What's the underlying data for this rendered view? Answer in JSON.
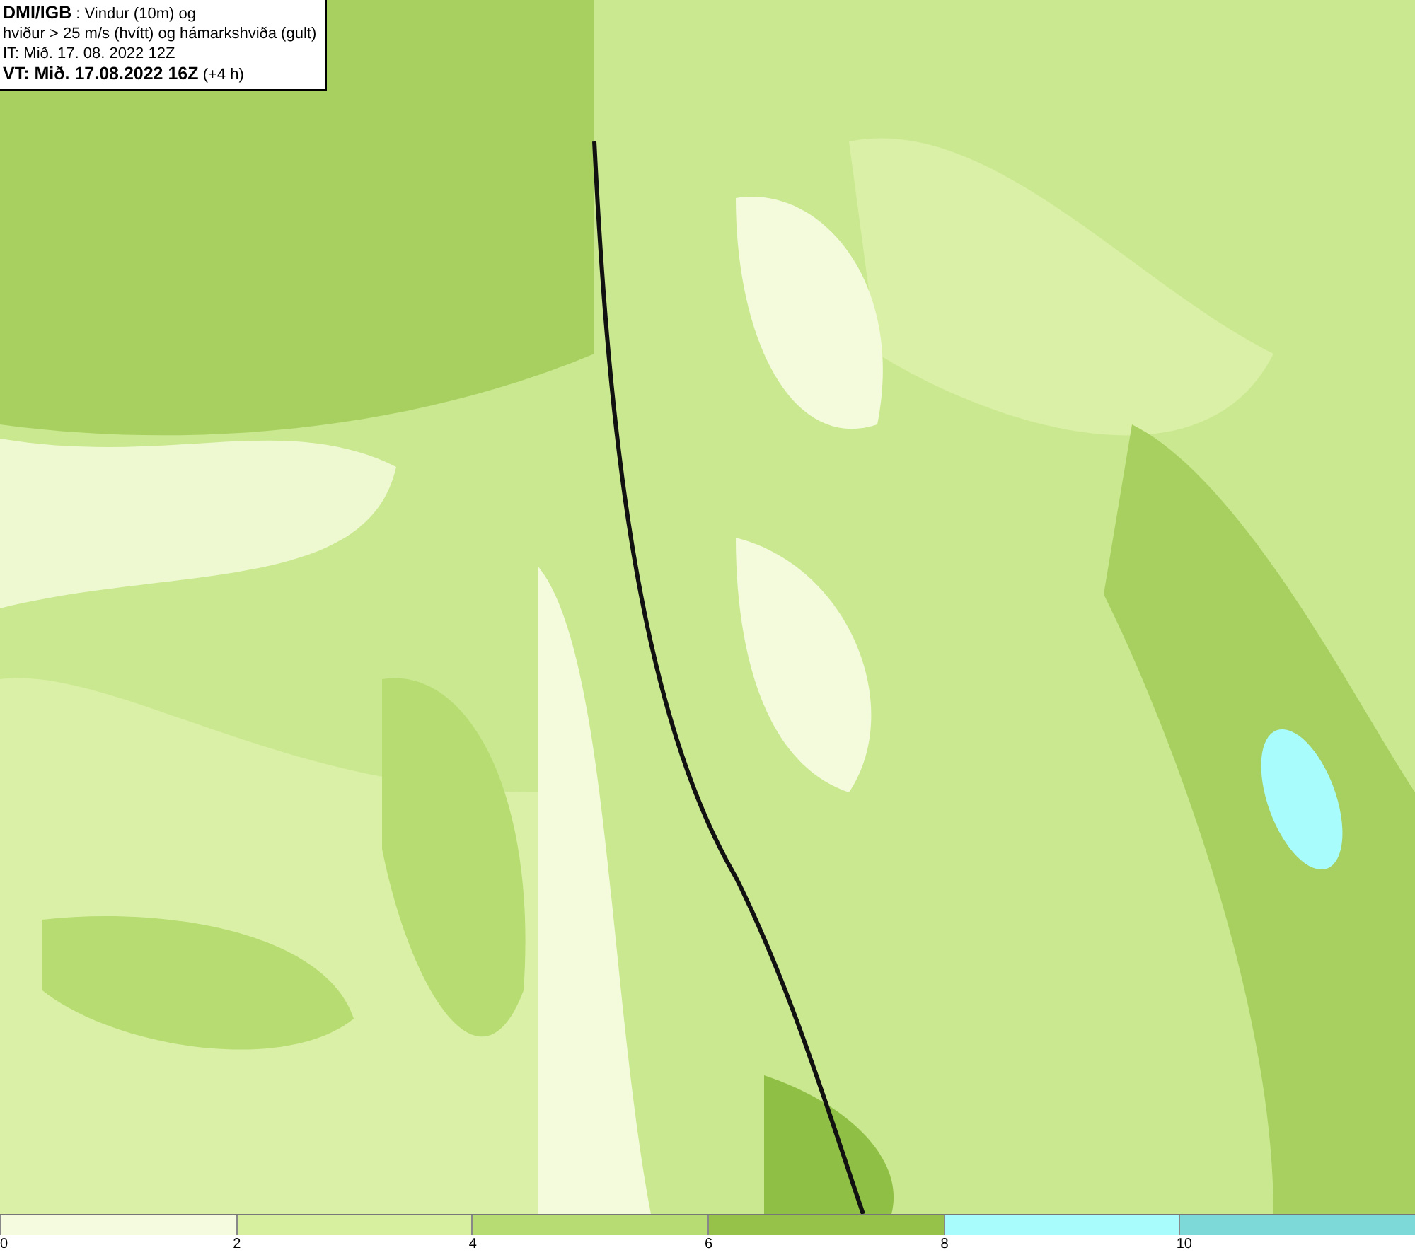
{
  "info_box": {
    "lines": [
      "**DMI/IGB** : Vindur (10m) og",
      "hviður > 25 m/s (hvítt) og hámarkshviða (gult)",
      "IT: Mið. 17. 08. 2022 12Z",
      "**VT: Mið. 17.08.2022 16Z** (+4 h)"
    ]
  },
  "legend": {
    "swatches": [
      {
        "color": "#f4fbde"
      },
      {
        "color": "#d7f0a0"
      },
      {
        "color": "#b8dc74"
      },
      {
        "color": "#96c24a"
      },
      {
        "color": "#a8fcfc"
      },
      {
        "color": "#7dd8d8"
      }
    ],
    "ticks": [
      "0",
      "2",
      "4",
      "6",
      "8",
      "10"
    ]
  }
}
